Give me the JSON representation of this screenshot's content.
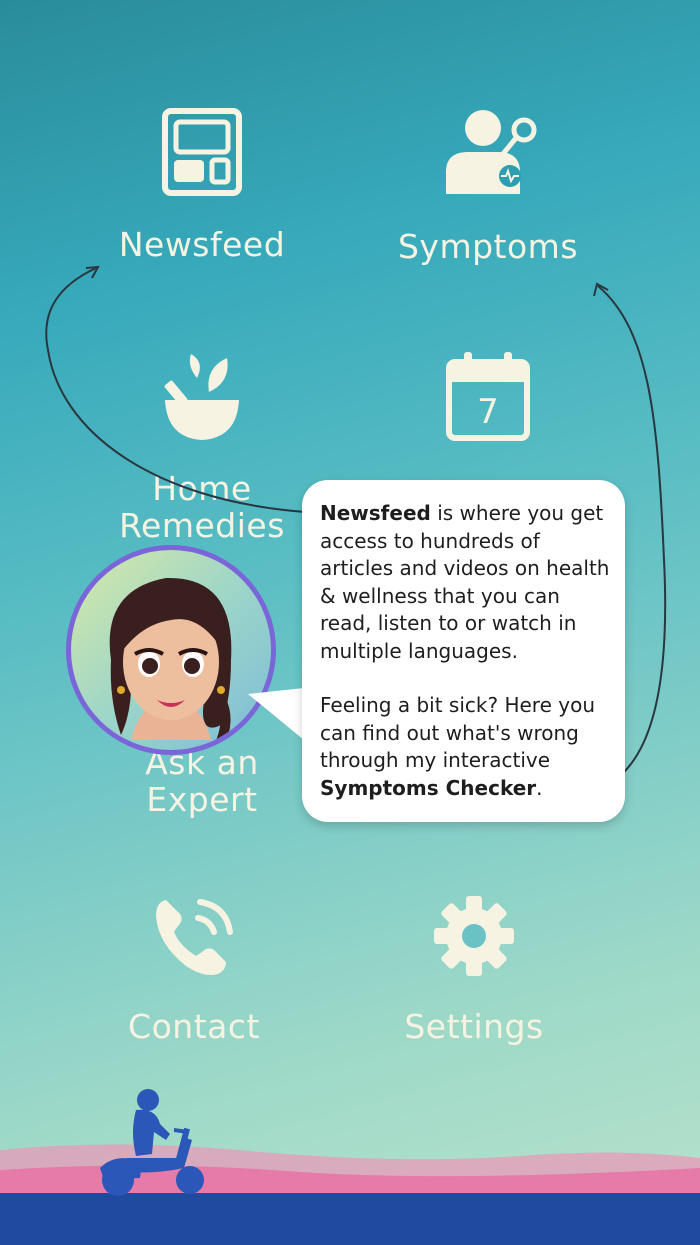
{
  "menu": {
    "newsfeed": "Newsfeed",
    "symptoms": "Symptoms",
    "remedies_line1": "Home",
    "remedies_line2": "Remedies",
    "calendar_day": "7",
    "ask_line1": "Ask an",
    "ask_line2": "Expert",
    "contact": "Contact",
    "settings": "Settings"
  },
  "tooltip": {
    "p1_bold": "Newsfeed",
    "p1_rest": " is where you get access to hundreds of articles and videos on health & wellness that you can read, listen to or watch in multiple languages.",
    "p2_start": "Feeling a bit sick? Here you can find out what's wrong through my interactive ",
    "p2_bold": "Symptoms Checker",
    "p2_end": "."
  },
  "colors": {
    "icon": "#f7f3e2",
    "avatar_ring": "#7a66d8",
    "ground_blue": "#1f4aa0",
    "ground_pink": "#e67aa8",
    "rider": "#2b57b8"
  },
  "icons": [
    "newsfeed-icon",
    "symptoms-icon",
    "bowl-leaf-icon",
    "calendar-icon",
    "phone-icon",
    "gear-icon"
  ]
}
